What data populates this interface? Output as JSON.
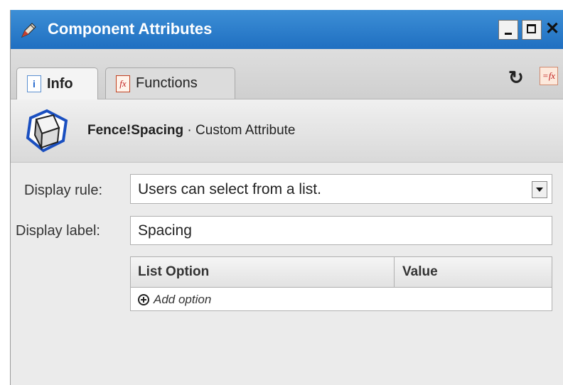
{
  "window": {
    "title": "Component Attributes",
    "title_bar_color": "#2a7ccb"
  },
  "tabs": [
    {
      "label": "Info",
      "icon": "info-icon",
      "selected": true
    },
    {
      "label": "Functions",
      "icon": "function-icon",
      "selected": false
    }
  ],
  "toolbar": {
    "refresh_icon": "refresh-icon",
    "formula_icon": "formula-icon"
  },
  "header": {
    "attribute_name": "Fence!Spacing",
    "attribute_type": " · Custom Attribute",
    "icon": "component-cube-icon"
  },
  "form": {
    "display_rule_label": "Display rule:",
    "display_rule_value": "Users can select from a list.",
    "display_label_label": "Display label:",
    "display_label_value": "Spacing"
  },
  "options_table": {
    "columns": [
      "List Option",
      "Value"
    ],
    "add_option_label": "Add option"
  }
}
